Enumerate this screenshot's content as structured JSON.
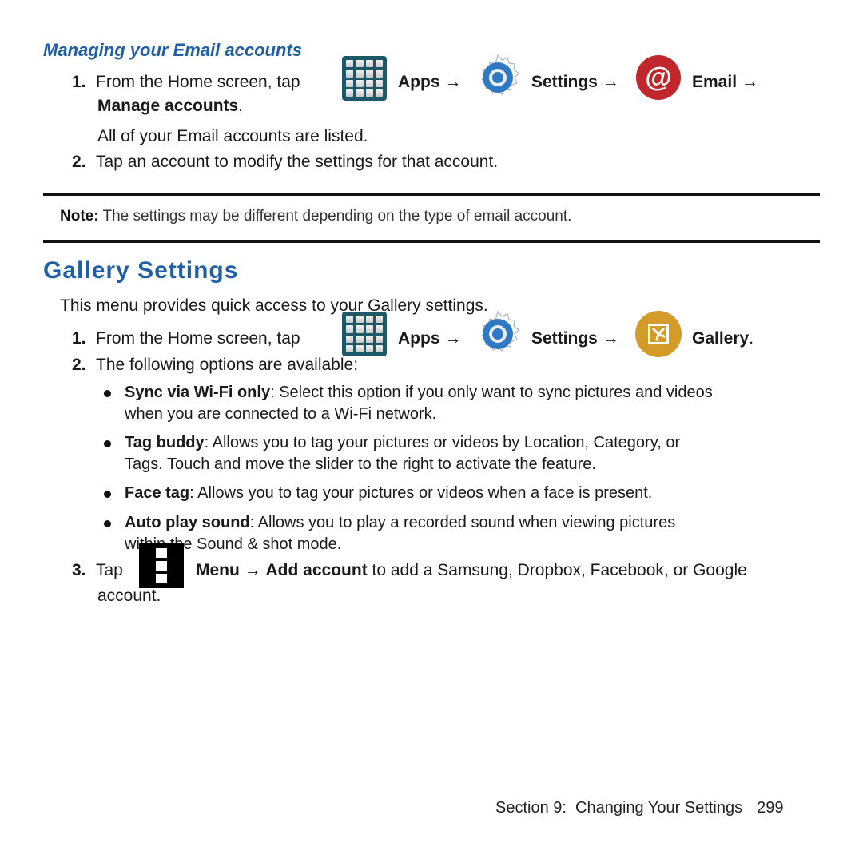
{
  "email_section": {
    "heading": "Managing your Email accounts",
    "step1": {
      "number": "1.",
      "prefix": "From the Home screen, tap",
      "apps": "Apps",
      "arrow": "→",
      "settings": "Settings",
      "email": "Email",
      "manage": "Manage accounts",
      "period": "."
    },
    "step1_result": "All of your Email accounts are listed.",
    "step2": {
      "number": "2.",
      "text": "Tap an account to modify the settings for that account."
    }
  },
  "note": {
    "label": "Note:",
    "text": " The settings may be different depending on the type of email account."
  },
  "gallery_section": {
    "heading": "Gallery Settings",
    "intro": "This menu provides quick access to your Gallery settings.",
    "step1": {
      "number": "1.",
      "prefix": "From the Home screen, tap",
      "apps": "Apps",
      "arrow": "→",
      "settings": "Settings",
      "gallery": "Gallery",
      "period": "."
    },
    "step2": {
      "number": "2.",
      "text": "The following options are available:"
    },
    "options": [
      {
        "term": "Sync via Wi-Fi only",
        "line1": ": Select this option if you only want to sync pictures and videos",
        "line2": "when you are connected to a Wi-Fi network."
      },
      {
        "term": "Tag buddy",
        "line1": ": Allows you to tag your pictures or videos by Location, Category, or",
        "line2": "Tags. Touch and move the slider to the right to activate the feature."
      },
      {
        "term": "Face tag",
        "line1": ": Allows you to tag your pictures or videos when a face is present.",
        "line2": ""
      },
      {
        "term": "Auto play sound",
        "line1": ": Allows you to play a recorded sound when viewing pictures",
        "line2": "within the Sound & shot mode."
      }
    ],
    "step3": {
      "number": "3.",
      "prefix": "Tap",
      "menu": "Menu",
      "arrow": "→",
      "add_account": "Add account",
      "suffix": " to add a Samsung, Dropbox, Facebook, or Google",
      "line2": "account."
    }
  },
  "icons": {
    "apps": "apps-grid-icon",
    "settings": "settings-gear-icon",
    "email": "email-at-icon",
    "email_glyph": "@",
    "gallery": "gallery-icon",
    "menu": "menu-dots-icon"
  },
  "colors": {
    "heading_blue": "#1f5fa8",
    "apps_teal": "#1c5868",
    "email_red": "#c0272d",
    "gallery_gold": "#d49a2a",
    "gear_blue": "#2f78c4"
  },
  "footer": {
    "section": "Section 9:  Changing Your Settings",
    "page_number": "299"
  }
}
